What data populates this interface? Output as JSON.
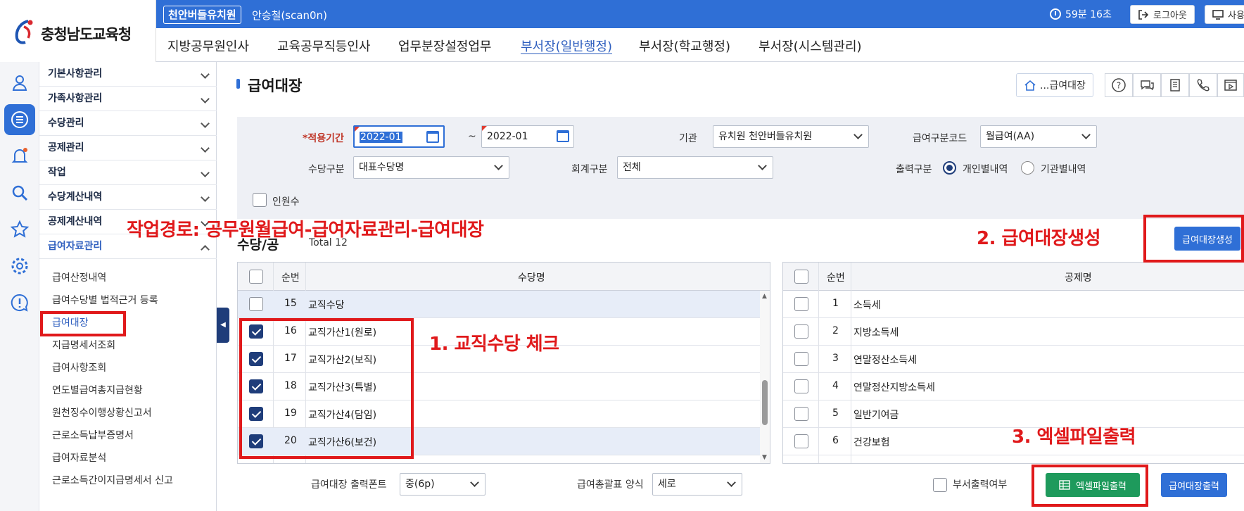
{
  "header": {
    "logo_text": "충청남도교육청",
    "org_badge": "천안버들유치원",
    "user": "안승철(scan0n)",
    "timer": "59분 16초",
    "logout": "로그아웃",
    "extra_btn": "사용"
  },
  "nav": [
    "지방공무원인사",
    "교육공무직등인사",
    "업무분장설정업무",
    "부서장(일반행정)",
    "부서장(학교행정)",
    "부서장(시스템관리)"
  ],
  "nav_active": "부서장(일반행정)",
  "rail_icons": [
    "person-icon",
    "list-icon",
    "bell-icon",
    "search-icon",
    "star-icon",
    "gear-icon",
    "alert-chat-icon"
  ],
  "sidebar": {
    "menus": [
      "기본사항관리",
      "가족사항관리",
      "수당관리",
      "공제관리",
      "작업",
      "수당계산내역",
      "공제계산내역",
      "급여자료관리"
    ],
    "sub_items": [
      "급여산정내역",
      "급여수당별 법적근거 등록",
      "급여대장",
      "지급명세서조회",
      "급여사항조회",
      "연도별급여총지급현황",
      "원천징수이행상황신고서",
      "근로소득납부증명서",
      "급여자료분석",
      "근로소득간이지급명세서 신고"
    ]
  },
  "page": {
    "title": "급여대장",
    "crumb": "...급여대장"
  },
  "filters": {
    "period_label": "*적용기간",
    "period_from": "2022-01",
    "period_sep": "~",
    "period_to": "2022-01",
    "org_label": "기관",
    "org_value": "유치원 천안버들유치원",
    "pay_code_label": "급여구분코드",
    "pay_code_value": "월급여(AA)",
    "allowance_label": "수당구분",
    "allowance_value": "대표수당명",
    "account_label": "회계구분",
    "account_value": "전체",
    "output_label": "출력구분",
    "output_opt1": "개인별내역",
    "output_opt2": "기관별내역",
    "headcount_label": "인원수"
  },
  "section": {
    "title": "수당/공",
    "total": "Total 12"
  },
  "allowance_grid": {
    "col_no": "순번",
    "col_name": "수당명",
    "rows": [
      {
        "no": "15",
        "name": "교직수당",
        "checked": false
      },
      {
        "no": "16",
        "name": "교직가산1(원로)",
        "checked": true
      },
      {
        "no": "17",
        "name": "교직가산2(보직)",
        "checked": true
      },
      {
        "no": "18",
        "name": "교직가산3(특별)",
        "checked": true
      },
      {
        "no": "19",
        "name": "교직가산4(담임)",
        "checked": true
      },
      {
        "no": "20",
        "name": "교직가산6(보건)",
        "checked": true
      }
    ]
  },
  "deduction_grid": {
    "col_no": "순번",
    "col_name": "공제명",
    "rows": [
      {
        "no": "1",
        "name": "소득세"
      },
      {
        "no": "2",
        "name": "지방소득세"
      },
      {
        "no": "3",
        "name": "연말정산소득세"
      },
      {
        "no": "4",
        "name": "연말정산지방소득세"
      },
      {
        "no": "5",
        "name": "일반기여금"
      },
      {
        "no": "6",
        "name": "건강보험"
      }
    ]
  },
  "bottom": {
    "font_label": "급여대장 출력폰트",
    "font_value": "중(6p)",
    "summary_label": "급여총괄표 양식",
    "summary_value": "세로",
    "dept_print_label": "부서출력여부",
    "excel_btn": "엑셀파일출력",
    "print_btn": "급여대장출력",
    "create_btn": "급여대장생성"
  },
  "annotations": {
    "path": "작업경로: 공무원월급여-급여자료관리-급여대장",
    "step1": "1. 교직수당 체크",
    "step2": "2. 급여대장생성",
    "step3": "3. 엑셀파일출력"
  },
  "colors": {
    "primary": "#2f6fd6",
    "annotation": "#e0191b",
    "excel": "#1e9a5c",
    "navy": "#1f3d7a"
  }
}
